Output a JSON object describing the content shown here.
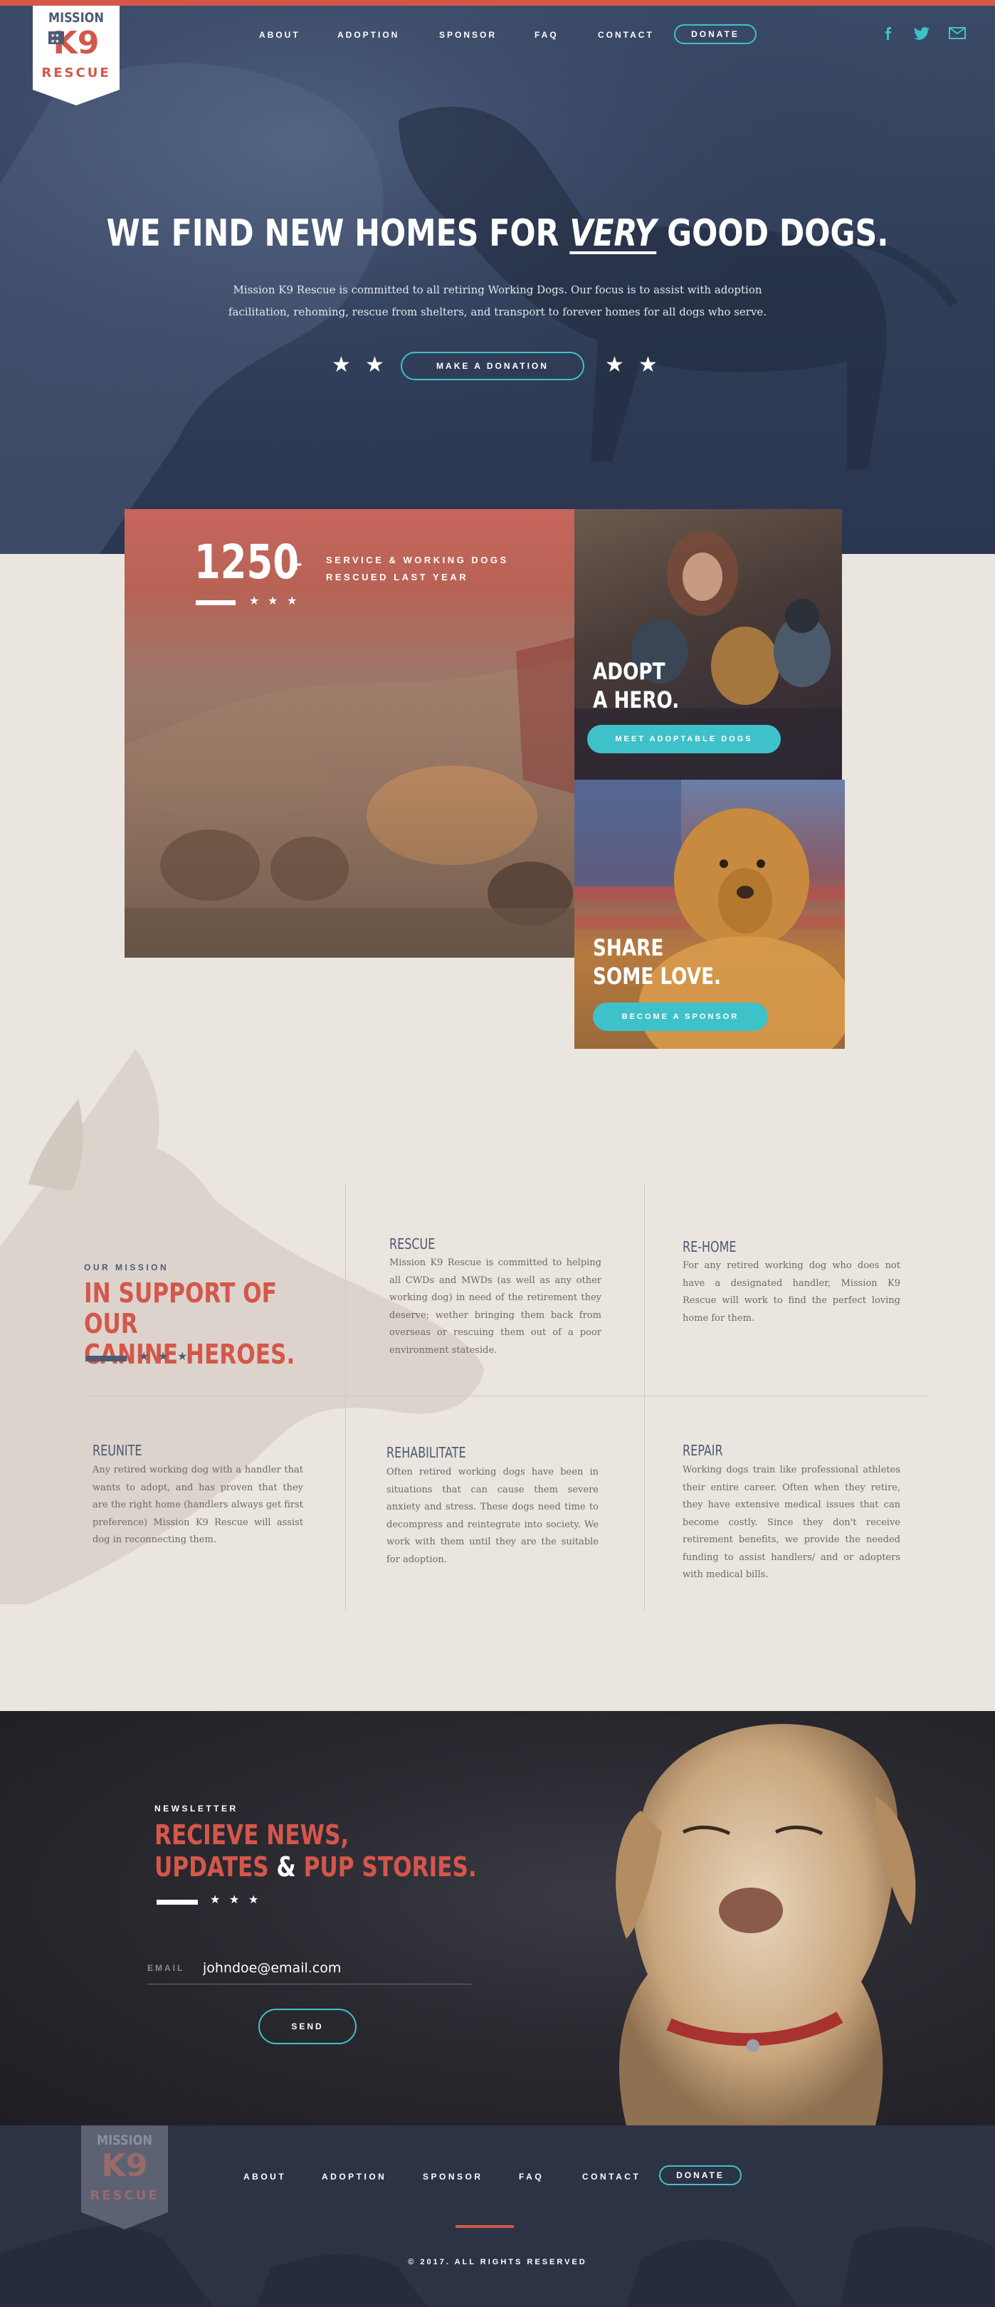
{
  "brand": {
    "logo_top": "MISSION",
    "logo_mid": "K9",
    "logo_bottom": "RESCUE",
    "colors": {
      "red": "#d4574a",
      "teal": "#3fc1c9",
      "navy": "#4d5a72",
      "cream": "#ebe5df"
    }
  },
  "nav": {
    "items": [
      "ABOUT",
      "ADOPTION",
      "SPONSOR",
      "FAQ",
      "CONTACT"
    ],
    "donate": "DONATE",
    "social": [
      "facebook-icon",
      "twitter-icon",
      "email-icon"
    ]
  },
  "hero": {
    "title_pre": "WE FIND NEW HOMES FOR",
    "title_em": "VERY",
    "title_post": "GOOD DOGS.",
    "lead": "Mission K9 Rescue is committed to all retiring Working Dogs. Our focus is to assist with adoption facilitation, rehoming, rescue from shelters, and transport to forever homes for all dogs who serve.",
    "cta": "MAKE A DONATION"
  },
  "stats": {
    "number": "1250",
    "plus": "+",
    "label_line1": "SERVICE & WORKING DOGS",
    "label_line2": "RESCUED LAST YEAR"
  },
  "adopt": {
    "title_line1": "ADOPT",
    "title_line2": "A HERO.",
    "button": "MEET ADOPTABLE DOGS"
  },
  "share": {
    "title_line1": "SHARE",
    "title_line2": "SOME LOVE.",
    "button": "BECOME A SPONSOR"
  },
  "mission": {
    "kicker": "OUR MISSION",
    "title_line1": "IN SUPPORT OF OUR",
    "title_line2": "CANINE HEROES.",
    "services": [
      {
        "title": "RESCUE",
        "text": "Mission K9 Rescue is committed to helping all CWDs and MWDs (as well as any other working dog) in need of the retirement they deserve; wether bringing them back from overseas or rescuing them out of a poor environment stateside."
      },
      {
        "title": "RE-HOME",
        "text": "For any retired working dog who does not have a designated handler, Mission K9 Rescue will work to find the perfect loving home for them."
      },
      {
        "title": "REUNITE",
        "text": "Any retired working dog with a handler that wants to adopt, and has proven that they are the right home (handlers always get first preference) Mission K9 Rescue will assist dog in reconnecting them."
      },
      {
        "title": "REHABILITATE",
        "text": "Often retired working dogs have been in situations that can cause them severe anxiety and stress. These dogs need time to decompress and reintegrate into society. We work with them until they are the suitable for adoption."
      },
      {
        "title": "REPAIR",
        "text": "Working dogs train like professional athletes their entire career.  Often when they retire, they have extensive medical issues that can become costly. Since they don't receive retirement benefits, we provide the needed funding to assist handlers/ and or adopters with medical bills."
      }
    ]
  },
  "newsletter": {
    "kicker": "NEWSLETTER",
    "title_line1": "RECIEVE NEWS,",
    "title_line2a": "UPDATES",
    "title_amp": "&",
    "title_line2b": "PUP STORIES.",
    "email_label": "EMAIL",
    "email_value": "johndoe@email.com",
    "send": "SEND"
  },
  "footer": {
    "items": [
      "ABOUT",
      "ADOPTION",
      "SPONSOR",
      "FAQ",
      "CONTACT"
    ],
    "donate": "DONATE",
    "copyright": "© 2017. ALL RIGHTS RESERVED"
  }
}
